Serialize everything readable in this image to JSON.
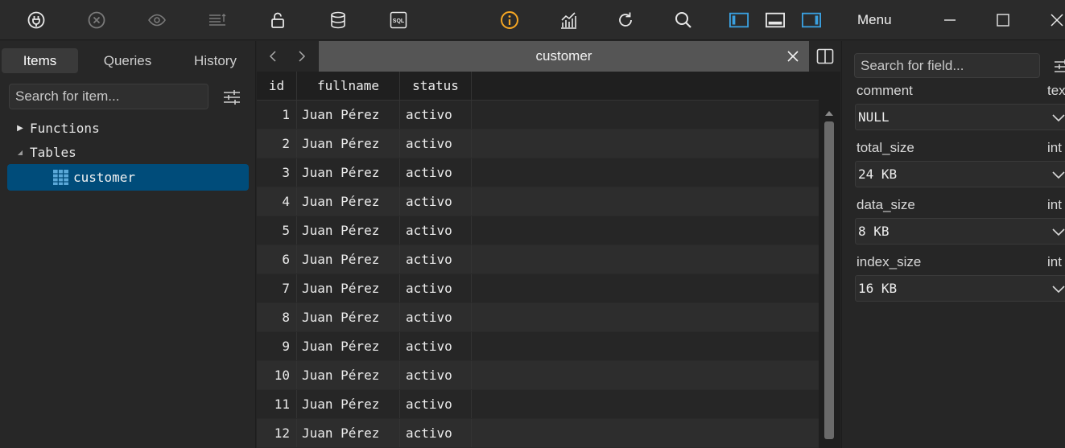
{
  "window": {
    "menu_label": "Menu"
  },
  "toolbar": {
    "icons": [
      "plug-icon",
      "close-circle-icon",
      "eye-icon",
      "sort-lines-icon",
      "lock-icon",
      "database-icon",
      "sql-icon",
      "info-icon",
      "stats-icon",
      "refresh-icon",
      "search-icon",
      "panel-left-icon",
      "panel-bottom-icon",
      "panel-right-icon"
    ],
    "sql_label": "SQL",
    "info_color": "#f5a623",
    "panel_accent": "#3aa0e0"
  },
  "left_panel": {
    "tabs": [
      "Items",
      "Queries",
      "History"
    ],
    "active_tab": "Items",
    "search_placeholder": "Search for item...",
    "tree": [
      {
        "label": "Functions",
        "expanded": false
      },
      {
        "label": "Tables",
        "expanded": true
      }
    ],
    "selected_item": "customer"
  },
  "center": {
    "tab_title": "customer",
    "columns": [
      "id",
      "fullname",
      "status"
    ],
    "rows": [
      [
        "1",
        "Juan Pérez",
        "activo"
      ],
      [
        "2",
        "Juan Pérez",
        "activo"
      ],
      [
        "3",
        "Juan Pérez",
        "activo"
      ],
      [
        "4",
        "Juan Pérez",
        "activo"
      ],
      [
        "5",
        "Juan Pérez",
        "activo"
      ],
      [
        "6",
        "Juan Pérez",
        "activo"
      ],
      [
        "7",
        "Juan Pérez",
        "activo"
      ],
      [
        "8",
        "Juan Pérez",
        "activo"
      ],
      [
        "9",
        "Juan Pérez",
        "activo"
      ],
      [
        "10",
        "Juan Pérez",
        "activo"
      ],
      [
        "11",
        "Juan Pérez",
        "activo"
      ],
      [
        "12",
        "Juan Pérez",
        "activo"
      ]
    ]
  },
  "right_panel": {
    "search_placeholder": "Search for field...",
    "fields": [
      {
        "name": "comment",
        "type": "tex",
        "value": "NULL"
      },
      {
        "name": "total_size",
        "type": "int",
        "value": "24 KB"
      },
      {
        "name": "data_size",
        "type": "int",
        "value": "8 KB"
      },
      {
        "name": "index_size",
        "type": "int",
        "value": "16 KB"
      }
    ]
  }
}
